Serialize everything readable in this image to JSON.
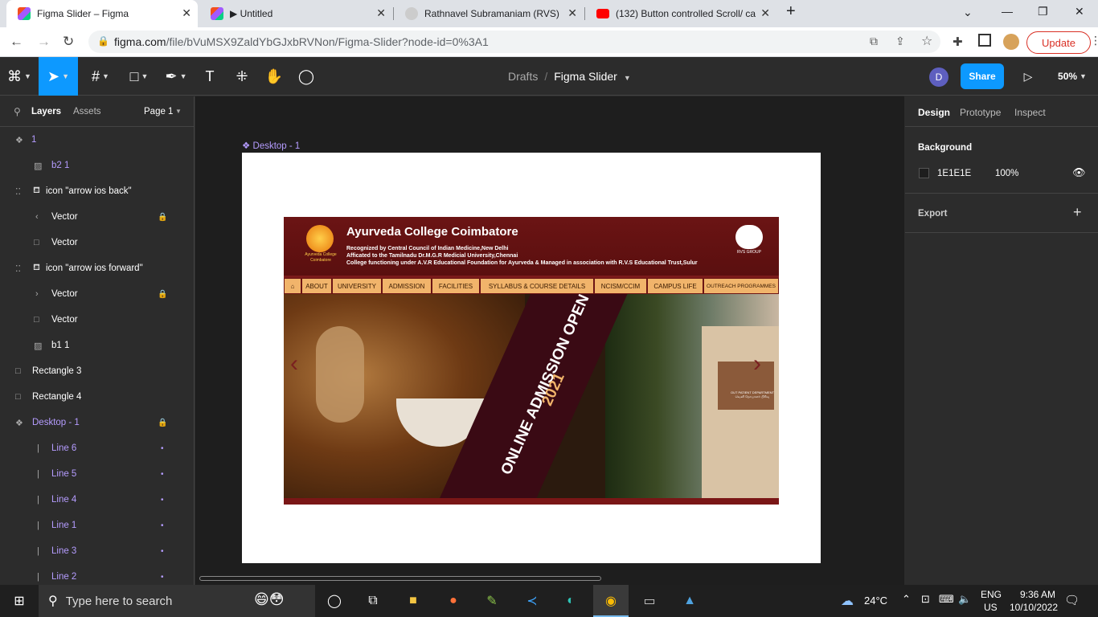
{
  "browser": {
    "tabs": [
      {
        "title": "Figma Slider – Figma",
        "active": true
      },
      {
        "title": "▶ Untitled",
        "active": false
      },
      {
        "title": "Rathnavel Subramaniam (RVS) Co",
        "active": false
      },
      {
        "title": "(132) Button controlled Scroll/ ca",
        "active": false
      }
    ],
    "url_host": "figma.com",
    "url_path": "/file/bVuMSX9ZaldYbGJxbRVNon/Figma-Slider?node-id=0%3A1",
    "update_label": "Update"
  },
  "figma": {
    "breadcrumb_drafts": "Drafts",
    "breadcrumb_sep": "/",
    "file_name": "Figma Slider",
    "avatar_initial": "D",
    "share_label": "Share",
    "zoom": "50%",
    "left_tabs": {
      "layers": "Layers",
      "assets": "Assets",
      "page": "Page 1"
    },
    "layers": [
      {
        "name": "1"
      },
      {
        "name": "b2 1"
      },
      {
        "name": "icon \"arrow ios back\""
      },
      {
        "name": "Vector"
      },
      {
        "name": "Vector"
      },
      {
        "name": "icon \"arrow ios forward\""
      },
      {
        "name": "Vector"
      },
      {
        "name": "Vector"
      },
      {
        "name": "b1 1"
      },
      {
        "name": "Rectangle 3"
      },
      {
        "name": "Rectangle 4"
      },
      {
        "name": "Desktop - 1"
      },
      {
        "name": "Line 6"
      },
      {
        "name": "Line 5"
      },
      {
        "name": "Line 4"
      },
      {
        "name": "Line 1"
      },
      {
        "name": "Line 3"
      },
      {
        "name": "Line 2"
      }
    ],
    "frame_label": "Desktop - 1",
    "right_tabs": {
      "design": "Design",
      "prototype": "Prototype",
      "inspect": "Inspect"
    },
    "background_label": "Background",
    "background_hex": "1E1E1E",
    "background_opacity": "100%",
    "export_label": "Export",
    "help_label": "?",
    "colors": {
      "accent": "#0d99ff",
      "component": "#b59cff"
    }
  },
  "site": {
    "title": "Ayurveda College Coimbatore",
    "line1": "Recognized by Central Council of Indian Medicine,New Delhi",
    "line2": "Afficated to the Tamilnadu Dr.M.G.R Medicial University,Chennai",
    "line3": "College functioning under A.V.R Educational Foundation for Ayurveda & Managed in association with R.V.S Educational Trust,Sulur",
    "logo_text": "Ayurveda College Coimbatore",
    "rvs_text": "RVS GROUP",
    "nav": [
      "ABOUT",
      "UNIVERSITY",
      "ADMISSION",
      "FACILITIES",
      "SYLLABUS & COURSE DETAILS",
      "NCISM/CCIM",
      "CAMPUS LIFE",
      "OUTREACH PROGRAMMES"
    ],
    "banner_line1": "ONLINE ADMISSION OPEN",
    "banner_line2": "2021",
    "sign_line1": "OUT PATIENT DEPARTMENT",
    "sign_line2": "வெளி நோயாளர் பிரிவு"
  },
  "taskbar": {
    "search_placeholder": "Type here to search",
    "weather": "24°C",
    "lang1": "ENG",
    "lang2": "US",
    "time": "9:36 AM",
    "date": "10/10/2022"
  }
}
